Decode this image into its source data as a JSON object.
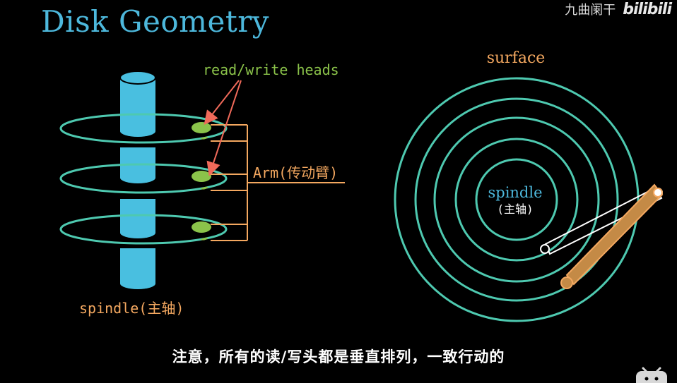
{
  "title": "Disk Geometry",
  "watermark": {
    "channel": "九曲阑干",
    "brand": "bilibili"
  },
  "left_diagram": {
    "heads_label": "read/write heads",
    "arm_label": "Arm(传动臂)",
    "spindle_label": "spindle(主轴)"
  },
  "right_diagram": {
    "surface_label": "surface",
    "spindle_label": "spindle",
    "spindle_cn": "(主轴)"
  },
  "subtitle": "注意，所有的读/写头都是垂直排列，一致行动的",
  "colors": {
    "title": "#4db8dc",
    "spindle_fill": "#49bfe0",
    "platter": "#4ec9b0",
    "head": "#8bc34a",
    "arm": "#f4a860",
    "arrow": "#f06a5a",
    "label_green": "#8bc34a",
    "label_orange": "#f4a860"
  }
}
